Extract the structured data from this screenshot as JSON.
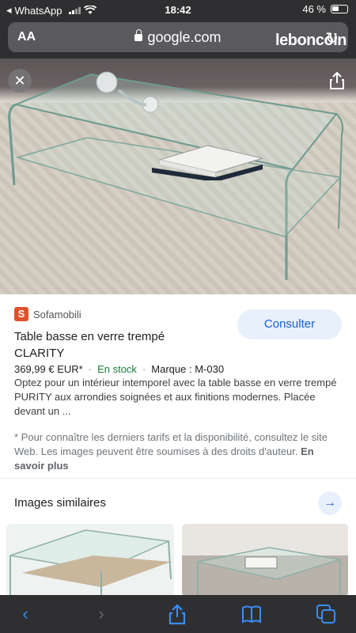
{
  "status": {
    "carrier": "WhatsApp",
    "time": "18:42",
    "battery": "46 %"
  },
  "address_bar": {
    "text_size": "AA",
    "url": "google.com"
  },
  "watermark": "leboncoin",
  "product": {
    "source": "Sofamobili",
    "source_logo_letter": "S",
    "consult_label": "Consulter",
    "title_line1": "Table basse en verre trempé",
    "title_line2": "CLARITY",
    "price": "369,99 € EUR*",
    "stock": "En stock",
    "brand": "Marque : M-030",
    "description": "Optez pour un intérieur intemporel avec la table basse en verre trempé PURITY aux arrondies soignées et aux finitions modernes. Placée devant un ...",
    "disclaimer": "* Pour connaître les derniers tarifs et la disponibilité, consultez le site Web. Les images peuvent être soumises à des droits d'auteur.",
    "learn_more": "En savoir plus"
  },
  "similar": {
    "label": "Images similaires"
  },
  "colors": {
    "accent": "#1a5fd0",
    "stock_green": "#188038",
    "toolbar_blue": "#3a8df5"
  }
}
